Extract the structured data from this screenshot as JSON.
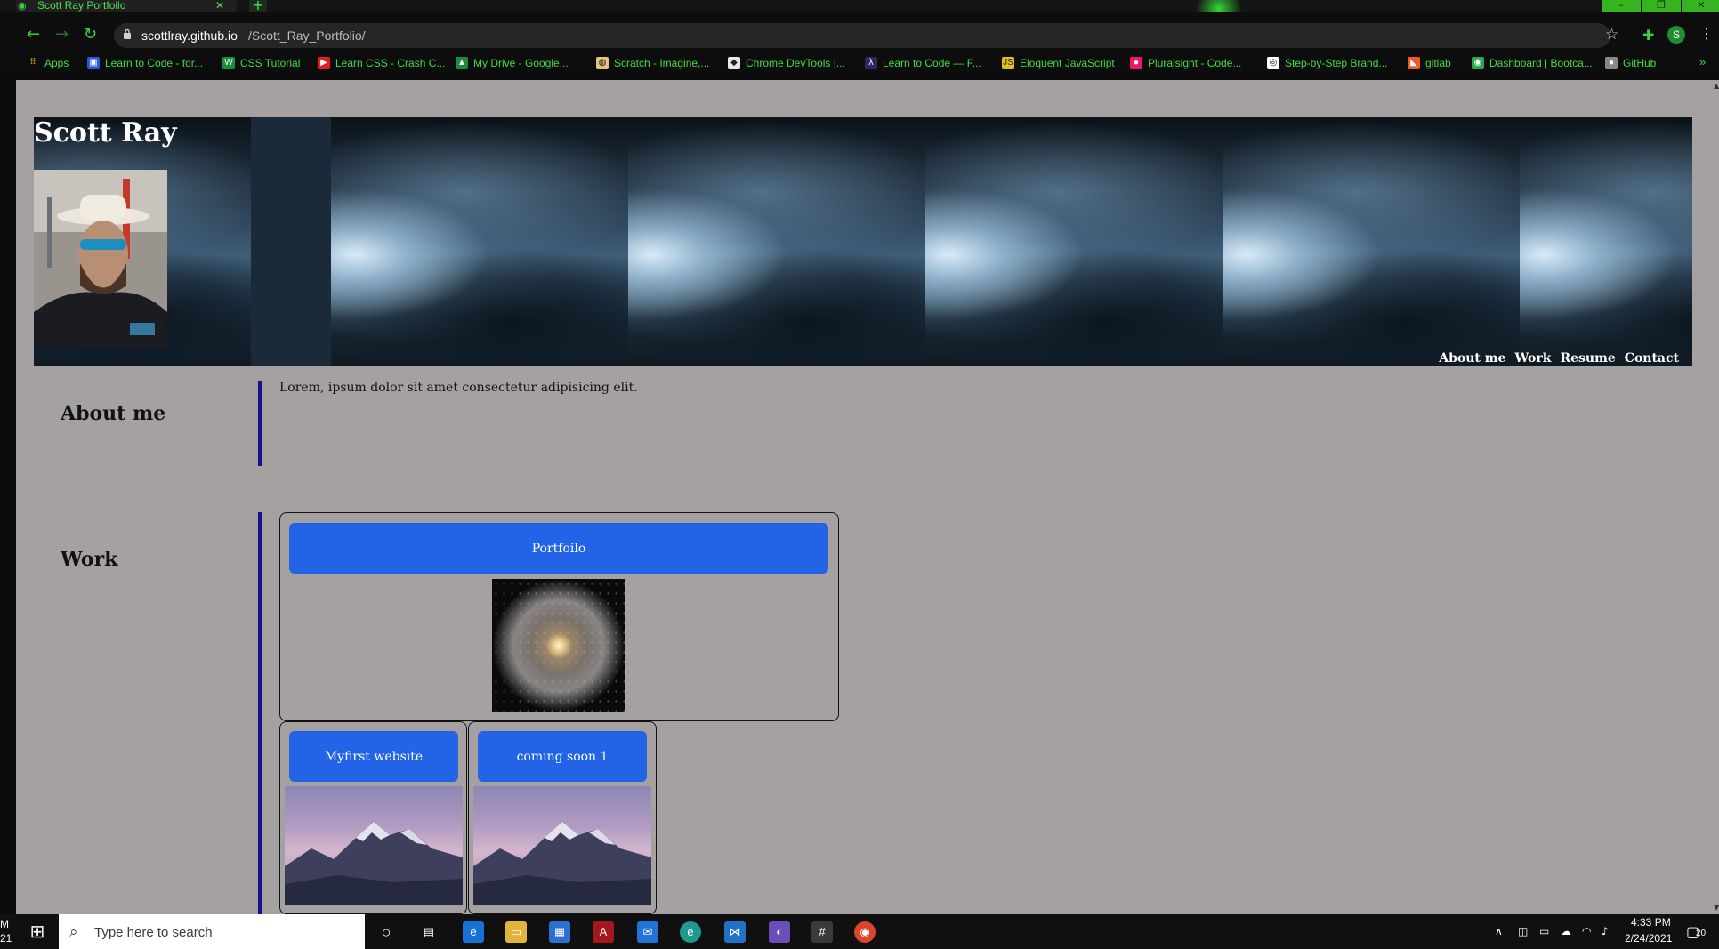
{
  "browser": {
    "tab_title": "Scott Ray Portfoilo",
    "url_host": "scottlray.github.io",
    "url_path": "/Scott_Ray_Portfolio/",
    "profile_initial": "S",
    "bookmarks": [
      {
        "label": "Apps",
        "icon": "apps-grid-icon"
      },
      {
        "label": "Learn to Code - for...",
        "icon": "freecodecamp-icon"
      },
      {
        "label": "CSS Tutorial",
        "icon": "w3schools-icon"
      },
      {
        "label": "Learn CSS - Crash C...",
        "icon": "youtube-icon"
      },
      {
        "label": "My Drive - Google...",
        "icon": "google-drive-icon"
      },
      {
        "label": "Scratch - Imagine,...",
        "icon": "scratch-icon"
      },
      {
        "label": "Chrome DevTools |...",
        "icon": "devtools-icon"
      },
      {
        "label": "Learn to Code — F...",
        "icon": "freecodecamp-icon"
      },
      {
        "label": "Eloquent JavaScript",
        "icon": "js-icon"
      },
      {
        "label": "Pluralsight - Code...",
        "icon": "pluralsight-icon"
      },
      {
        "label": "Step-by-Step Brand...",
        "icon": "brand-icon"
      },
      {
        "label": "gitlab",
        "icon": "gitlab-icon"
      },
      {
        "label": "Dashboard | Bootca...",
        "icon": "bootcamp-icon"
      },
      {
        "label": "GitHub",
        "icon": "github-icon"
      }
    ]
  },
  "site": {
    "title": "Scott Ray",
    "nav": [
      "About me",
      "Work",
      "Resume",
      "Contact"
    ],
    "about": {
      "heading": "About me",
      "text": "Lorem, ipsum dolor sit amet consectetur adipisicing elit."
    },
    "work": {
      "heading": "Work",
      "projects": [
        {
          "label": "Portfoilo",
          "image": "star-cluster"
        },
        {
          "label": "Myfirst website",
          "image": "mountains"
        },
        {
          "label": "coming soon 1",
          "image": "mountains"
        }
      ]
    }
  },
  "taskbar": {
    "search_placeholder": "Type here to search",
    "time": "4:33 PM",
    "date": "2/24/2021",
    "notification_count": "20",
    "left_edge_text": [
      "M",
      "21"
    ]
  }
}
